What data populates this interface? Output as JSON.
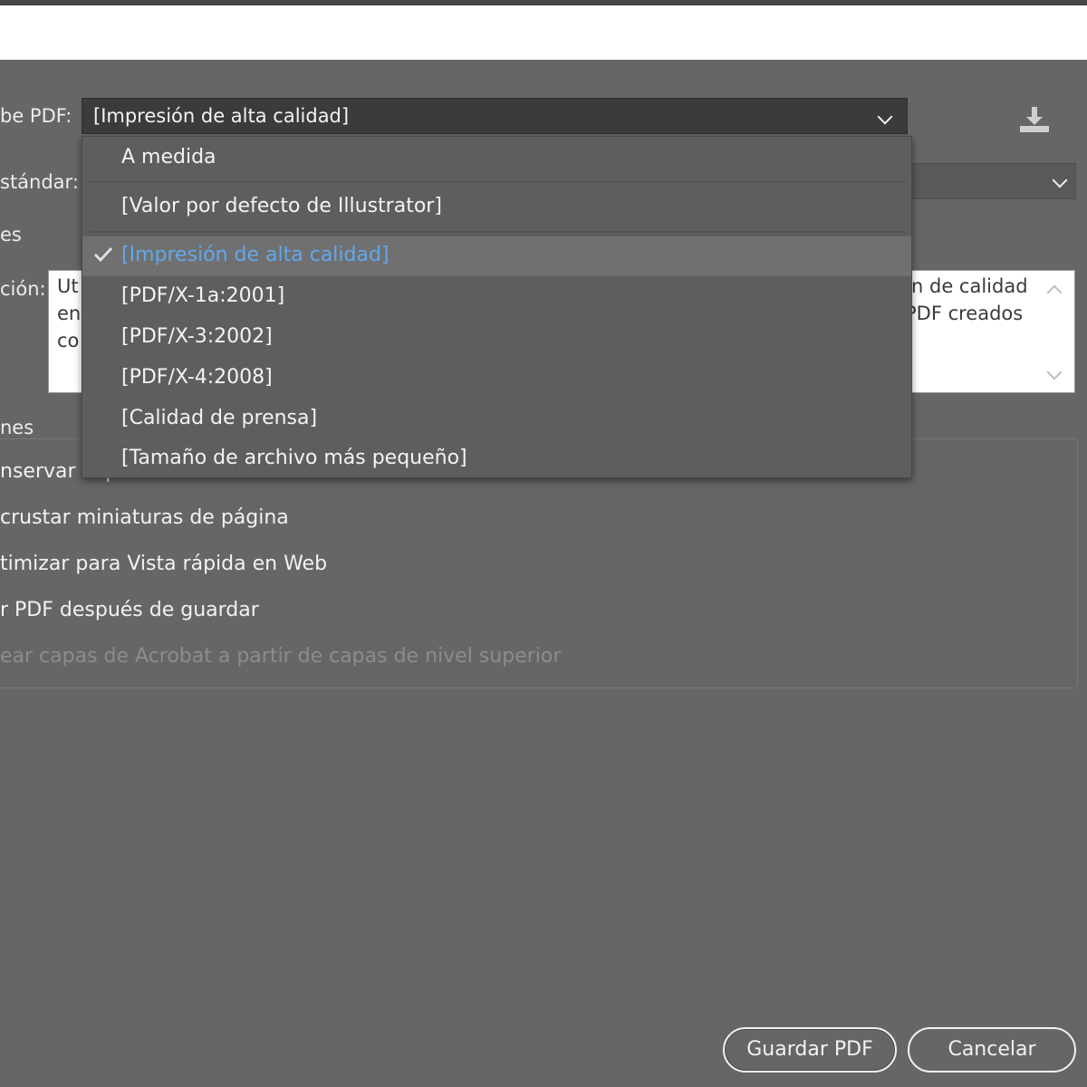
{
  "labels": {
    "preset": "be PDF:",
    "standard": "stándar:",
    "compat_partial": "es",
    "description": "ción:",
    "options_group": "nes"
  },
  "preset_select": {
    "value": "[Impresión de alta calidad]"
  },
  "description_text": {
    "left_lines": [
      "Ut",
      "en",
      "co"
    ],
    "right_lines": [
      "n de calidad",
      "PDF creados"
    ]
  },
  "options": [
    {
      "label": "nservar capacidades de edición de Illustrator",
      "enabled": true
    },
    {
      "label": "crustar miniaturas de página",
      "enabled": true
    },
    {
      "label": "timizar para Vista rápida en Web",
      "enabled": true
    },
    {
      "label": "r PDF después de guardar",
      "enabled": true
    },
    {
      "label": "ear capas de Acrobat a partir de capas de nivel superior",
      "enabled": false
    }
  ],
  "menu": {
    "items": [
      {
        "label": "A medida",
        "selected": false
      },
      {
        "label": "[Valor por defecto de Illustrator]",
        "selected": false
      },
      {
        "label": "[Impresión de alta calidad]",
        "selected": true
      },
      {
        "label": "[PDF/X-1a:2001]",
        "selected": false
      },
      {
        "label": "[PDF/X-3:2002]",
        "selected": false
      },
      {
        "label": "[PDF/X-4:2008]",
        "selected": false
      },
      {
        "label": "[Calidad de prensa]",
        "selected": false
      },
      {
        "label": "[Tamaño de archivo más pequeño]",
        "selected": false
      }
    ]
  },
  "buttons": {
    "save": "Guardar PDF",
    "cancel": "Cancelar"
  },
  "colors": {
    "background": "#666666",
    "selected_text": "#62a8ec",
    "menu_bg": "#5e5e5e"
  },
  "icons": {
    "download": "download-preset-icon",
    "check": "checkmark-icon",
    "chevron": "chevron-down-icon"
  }
}
